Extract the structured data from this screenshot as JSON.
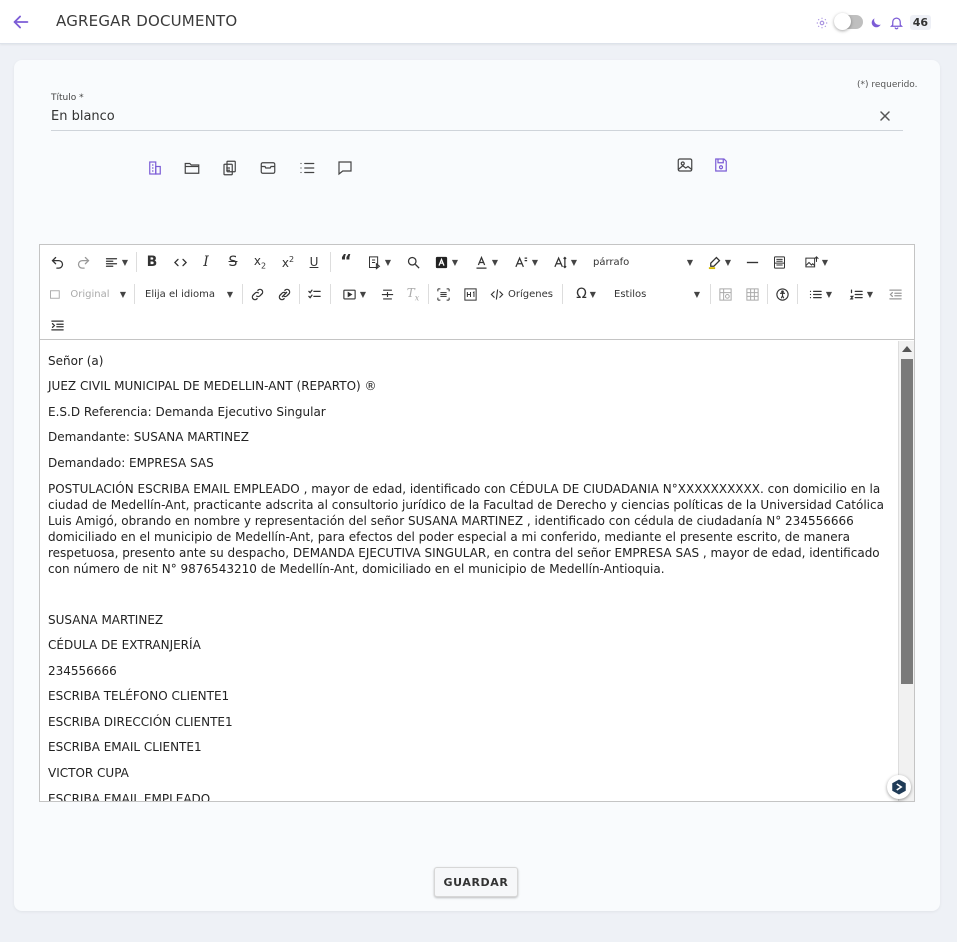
{
  "header": {
    "title": "AGREGAR DOCUMENTO",
    "notification_count": "46"
  },
  "form": {
    "required_note": "(*) requerido.",
    "title_label": "Título *",
    "title_value": "En blanco"
  },
  "toolbar": {
    "format_dropdown": "párrafo",
    "image_size_dropdown": "Original",
    "language_dropdown": "Elija el idioma",
    "source_button": "Orígenes",
    "styles_dropdown": "Estilos"
  },
  "document": {
    "lines": [
      "Señor (a)",
      "JUEZ CIVIL MUNICIPAL DE MEDELLIN-ANT (REPARTO) ®",
      "E.S.D Referencia: Demanda Ejecutivo Singular",
      "Demandante: SUSANA MARTINEZ",
      "Demandado: EMPRESA SAS"
    ],
    "paragraph": "POSTULACIÓN ESCRIBA EMAIL EMPLEADO ,  mayor de edad, identificado con CÉDULA DE CIUDADANIA N°XXXXXXXXXX. con domicilio en la ciudad de Medellín-Ant, practicante adscrita al consultorio jurídico de la Facultad de Derecho y ciencias políticas de la Universidad Católica Luis Amigó, obrando en nombre y representación del señor SUSANA MARTINEZ , identificado con cédula de ciudadanía N° 234556666 domiciliado en el municipio de Medellín-Ant, para efectos del poder especial a mi conferido, mediante el presente escrito, de manera respetuosa, presento ante su despacho, DEMANDA EJECUTIVA SINGULAR, en contra del señor EMPRESA SAS , mayor de edad, identificado con número de nit N° 9876543210 de Medellín-Ant, domiciliado en el municipio de Medellín-Antioquia.",
    "signature_lines": [
      "SUSANA MARTINEZ",
      "CÉDULA DE EXTRANJERÍA",
      "234556666",
      "ESCRIBA TELÉFONO CLIENTE1",
      "ESCRIBA DIRECCIÓN CLIENTE1",
      "ESCRIBA EMAIL CLIENTE1",
      "VICTOR CUPA",
      "ESCRIBA EMAIL EMPLEADO"
    ]
  },
  "actions": {
    "save_label": "GUARDAR"
  },
  "colors": {
    "accent": "#7c5cd6"
  }
}
